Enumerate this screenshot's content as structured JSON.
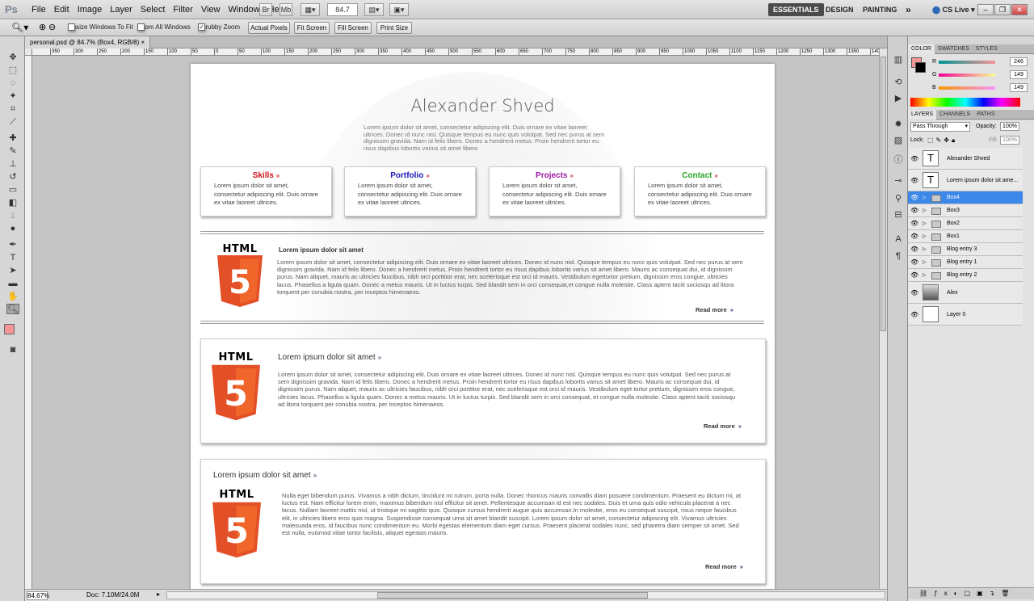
{
  "app": {
    "logo": "Ps",
    "menus": [
      "File",
      "Edit",
      "Image",
      "Layer",
      "Select",
      "Filter",
      "View",
      "Window",
      "Help"
    ],
    "zoom_display": "84.7",
    "workspaces": [
      "ESSENTIALS",
      "DESIGN",
      "PAINTING"
    ],
    "more": "»",
    "cslive": "CS Live"
  },
  "options": {
    "resize_windows": "Resize Windows To Fit",
    "zoom_all": "Zoom All Windows",
    "scrubby": "Scrubby Zoom",
    "buttons": [
      "Actual Pixels",
      "Fit Screen",
      "Fill Screen",
      "Print Size"
    ]
  },
  "document": {
    "tab_title": "personal.psd @ 84.7% (Box4, RGB/8)",
    "close": "×",
    "status_zoom": "84.67%",
    "status_doc": "Doc: 7.10M/24.0M"
  },
  "ruler_h": [
    "350",
    "300",
    "250",
    "200",
    "150",
    "100",
    "50",
    "0",
    "50",
    "100",
    "150",
    "200",
    "250",
    "300",
    "350",
    "400",
    "450",
    "500",
    "550",
    "600",
    "650",
    "700",
    "750",
    "800",
    "850",
    "900",
    "950",
    "1000",
    "1050",
    "1100",
    "1150",
    "1200",
    "1250",
    "1300",
    "1350",
    "1400",
    "1450"
  ],
  "site": {
    "title": "Alexander Shved",
    "intro": "Lorem ipsum dolor sit amet, consectetur adipiscing elit. Duis ornare ex vitae laoreet ultrices. Donec id nunc nisl. Quisque tempus eu nunc quis volutpat. Sed nec purus at sem dignissim gravida. Nam id felis libero. Donec a hendrerit metus. Proin hendrerit tortor eu risus dapibus lobortis varius sit amet libero",
    "cards": [
      {
        "title": "Skills",
        "color": "#d0141c",
        "text": "Lorem ipsum dolor sit amet, consectetur adipiscing elit. Duis ornare ex vitae laoreet ultrices."
      },
      {
        "title": "Portfolio",
        "color": "#1b1bb8",
        "text": "Lorem ipsum dolor sit amet, consectetur adipiscing elit. Duis ornare ex vitae laoreet ultrices."
      },
      {
        "title": "Projects",
        "color": "#9b1ba8",
        "text": "Lorem ipsum dolor sit amet, consectetur adipiscing elit. Duis ornare ex vitae laoreet ultrices."
      },
      {
        "title": "Contact",
        "color": "#2aa52a",
        "text": "Lorem ipsum dolor sit amet, consectetur adipiscing elit. Duis ornare ex vitae laoreet ultrices."
      }
    ],
    "arrow": "»",
    "html_label": "HTML",
    "html_digit": "5",
    "entries": [
      {
        "title": "Lorem ipsum dolor sit amet",
        "body": "Lorem ipsum dolor sit amet, consectetur adipiscing elit. Duis ornare ex vitae laoreet ultrices. Donec id nunc nisl. Quisque tempus eu nunc quis volutpat. Sed nec purus at sem dignissim gravida. Nam id felis libero. Donec a hendrerit metus. Proin hendrerit tortor eu risus dapibus lobortis varius sit amet libero. Mauris ac consequat dui, id dignissim purus. Nam aliquet, mauris ac ultricies faucibus, nibh orci porttitor erat, nec scelerisque est orci id mauris. Vestibulum egettortor pretium, dignissim eros congue, ultricies lacus. Phasellus a ligula quam. Donec a metus mauris. Ut in luctus turpis. Sed blandit sem in orci consequat,et congue nulla molestie. Class aptent taciti sociosqu ad litora torquent per conubia nostra, per inceptos himenaeos.",
        "more": "Read more"
      },
      {
        "title": "Lorem ipsum dolor sit amet",
        "body": "Lorem ipsum dolor sit amet, consectetur adipiscing elit. Duis ornare ex vitae laoreet ultrices. Donec id nunc nisl. Quisque tempus eu nunc quis volutpat. Sed nec purus at sem dignissim gravida. Nam id felis libero. Donec a hendrerit metus. Proin hendrerit tortor eu risus dapibus lobortis varius sit amet libero. Mauris ac consequat dui, id dignissim purus. Nam aliquet, mauris ac ultricies faucibus, nibh orci porttitor erat, nec scelerisque est orci id mauris. Vestibulum eget tortor pretium, dignissim eros congue, ultricies lacus. Phasellus a ligula quam. Donec a metus mauris. Ut in luctus turpis. Sed blandit sem in orci consequat, et congue nulla molestie. Class aptent taciti sociosqu ad litora torquent per conubia nostra, per inceptos himenaeos.",
        "more": "Read more"
      },
      {
        "title": "Lorem ipsum dolor sit amet",
        "body": "Nulla eget bibendum purus. Vivamus a nibh dictum, tincidunt mi rutrum, porta nulla. Donec rhoncus mauris convallis diam posuere condimentum. Praesent eu dictum mi, at luctus est. Nam efficitur lorem enim, maximus bibendum nisl efficitur sit amet. Pellentesque accumsan id est nec sodales. Duis et urna quis odio vehicula placerat a nec lacus. Nullam laoreet mattis nisl, ut tristique mi sagittis quis. Quisque cursus hendrerit augue quis accumsan.In molestie, eros eu consequat suscipit, risus neque faucibus elit, in ultricies libero eros quis magna. Suspendisse consequat urna sit amet blandit suscipit. Lorem ipsum dolor sit amet, consectetur adipiscing elit. Vivamus ultricies malesuada eros, id faucibus nunc condimentum eu. Morbi egestas elementum diam eget cursus. Praesent placerat sodales nunc, sed pharetra diam semper sit amet. Sed est nulla, euismod vitae tortor facilisis, aliquet egestas mauris.",
        "more": "Read more"
      }
    ]
  },
  "color_panel": {
    "tabs": [
      "COLOR",
      "SWATCHES",
      "STYLES"
    ],
    "r_label": "R",
    "g_label": "G",
    "b_label": "B",
    "r": "246",
    "g": "149",
    "b": "149",
    "fg": "#f69595"
  },
  "layers_panel": {
    "tabs": [
      "LAYERS",
      "CHANNELS",
      "PATHS"
    ],
    "blend": "Pass Through",
    "opacity_label": "Opacity:",
    "opacity": "100%",
    "lock_label": "Lock:",
    "fill_label": "Fill:",
    "fill": "100%",
    "layers": [
      "Alexander Shved",
      "Lorem ipsum dolor sit ame...",
      "Box4",
      "Box3",
      "Box2",
      "Box1",
      "Blog entry 3",
      "Blog entry 1",
      "Blog entry 2",
      "Alex",
      "Layer 0"
    ]
  }
}
